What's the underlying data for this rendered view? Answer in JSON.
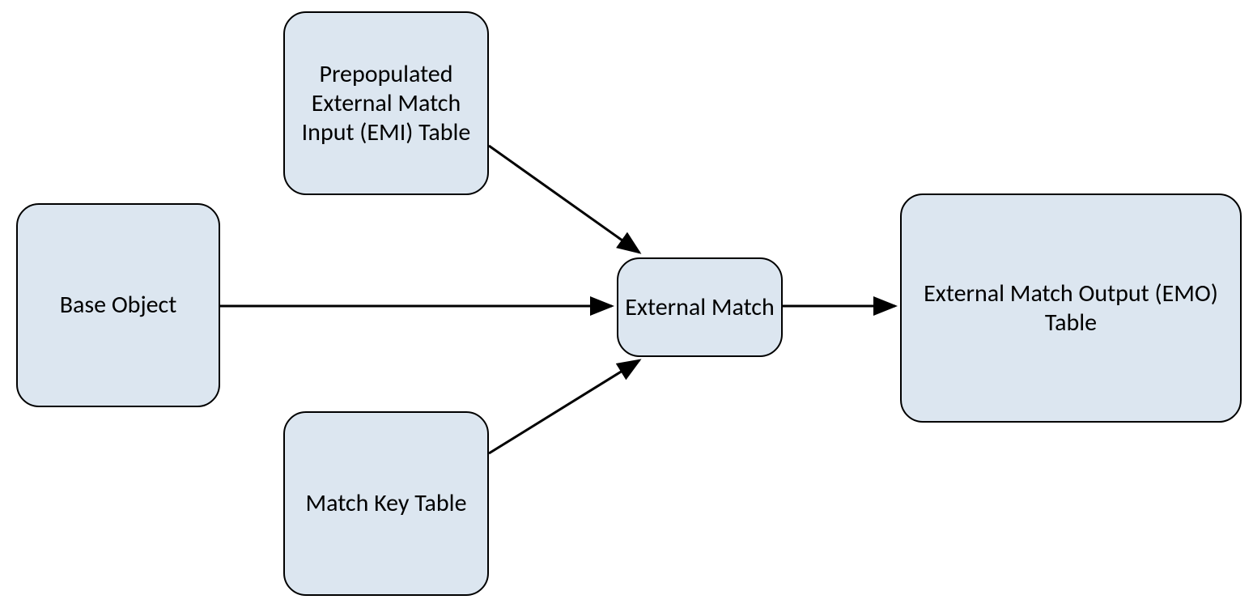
{
  "nodes": {
    "base_object": {
      "label": "Base Object"
    },
    "emi_table": {
      "label": "Prepopulated External Match Input (EMI) Table"
    },
    "match_key_table": {
      "label": "Match Key Table"
    },
    "external_match": {
      "label": "External Match"
    },
    "emo_table": {
      "label": "External Match Output (EMO) Table"
    }
  }
}
